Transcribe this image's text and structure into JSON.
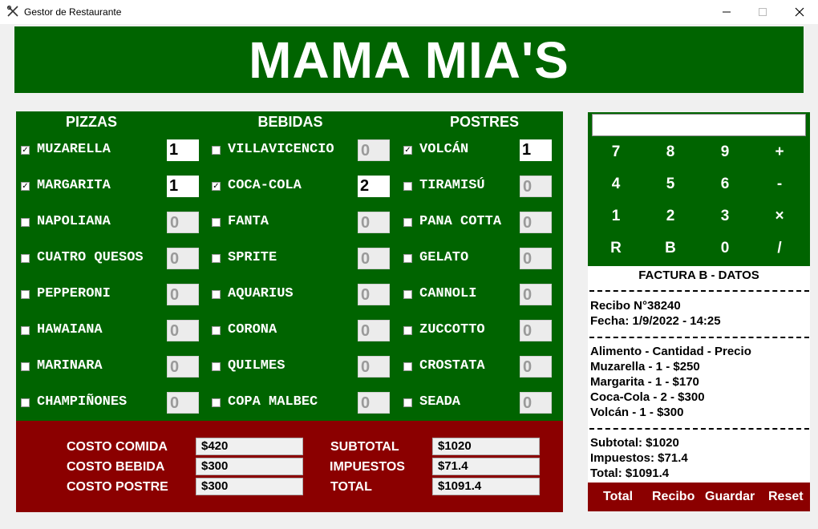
{
  "window": {
    "title": "Gestor de Restaurante"
  },
  "header": {
    "title": "MAMA MIA'S"
  },
  "menu": {
    "columns": [
      {
        "title": "PIZZAS",
        "items": [
          {
            "label": "MUZARELLA",
            "checked": true,
            "qty": "1"
          },
          {
            "label": "MARGARITA",
            "checked": true,
            "qty": "1"
          },
          {
            "label": "NAPOLIANA",
            "checked": false,
            "qty": "0"
          },
          {
            "label": "CUATRO QUESOS",
            "checked": false,
            "qty": "0"
          },
          {
            "label": "PEPPERONI",
            "checked": false,
            "qty": "0"
          },
          {
            "label": "HAWAIANA",
            "checked": false,
            "qty": "0"
          },
          {
            "label": "MARINARA",
            "checked": false,
            "qty": "0"
          },
          {
            "label": "CHAMPIÑONES",
            "checked": false,
            "qty": "0"
          }
        ]
      },
      {
        "title": "BEBIDAS",
        "items": [
          {
            "label": "VILLAVICENCIO",
            "checked": false,
            "qty": "0"
          },
          {
            "label": "COCA-COLA",
            "checked": true,
            "qty": "2"
          },
          {
            "label": "FANTA",
            "checked": false,
            "qty": "0"
          },
          {
            "label": "SPRITE",
            "checked": false,
            "qty": "0"
          },
          {
            "label": "AQUARIUS",
            "checked": false,
            "qty": "0"
          },
          {
            "label": "CORONA",
            "checked": false,
            "qty": "0"
          },
          {
            "label": "QUILMES",
            "checked": false,
            "qty": "0"
          },
          {
            "label": "COPA MALBEC",
            "checked": false,
            "qty": "0"
          }
        ]
      },
      {
        "title": "POSTRES",
        "items": [
          {
            "label": "VOLCÁN",
            "checked": true,
            "qty": "1"
          },
          {
            "label": "TIRAMISÚ",
            "checked": false,
            "qty": "0"
          },
          {
            "label": "PANA COTTA",
            "checked": false,
            "qty": "0"
          },
          {
            "label": "GELATO",
            "checked": false,
            "qty": "0"
          },
          {
            "label": "CANNOLI",
            "checked": false,
            "qty": "0"
          },
          {
            "label": "ZUCCOTTO",
            "checked": false,
            "qty": "0"
          },
          {
            "label": "CROSTATA",
            "checked": false,
            "qty": "0"
          },
          {
            "label": "SEADA",
            "checked": false,
            "qty": "0"
          }
        ]
      }
    ]
  },
  "costs": {
    "comida_label": "COSTO COMIDA",
    "comida_value": "$420",
    "bebida_label": "COSTO BEBIDA",
    "bebida_value": "$300",
    "postre_label": "COSTO POSTRE",
    "postre_value": "$300",
    "subtotal_label": "SUBTOTAL",
    "subtotal_value": "$1020",
    "impuestos_label": "IMPUESTOS",
    "impuestos_value": "$71.4",
    "total_label": "TOTAL",
    "total_value": "$1091.4"
  },
  "calculator": {
    "display": "",
    "keys": [
      [
        "7",
        "8",
        "9",
        "+"
      ],
      [
        "4",
        "5",
        "6",
        "-"
      ],
      [
        "1",
        "2",
        "3",
        "×"
      ],
      [
        "R",
        "B",
        "0",
        "/"
      ]
    ]
  },
  "receipt": {
    "title": "FACTURA B - DATOS",
    "recibo": "Recibo N°38240",
    "fecha": "Fecha: 1/9/2022 - 14:25",
    "header": "Alimento - Cantidad - Precio",
    "items": [
      "Muzarella - 1 - $250",
      "Margarita - 1 - $170",
      "Coca-Cola - 2 - $300",
      "Volcán - 1 - $300"
    ],
    "subtotal": "Subtotal: $1020",
    "impuestos": "Impuestos: $71.4",
    "total": "Total: $1091.4"
  },
  "buttons": {
    "total": "Total",
    "recibo": "Recibo",
    "guardar": "Guardar",
    "reset": "Reset"
  },
  "colors": {
    "green": "#006400",
    "red": "#8b0000"
  }
}
